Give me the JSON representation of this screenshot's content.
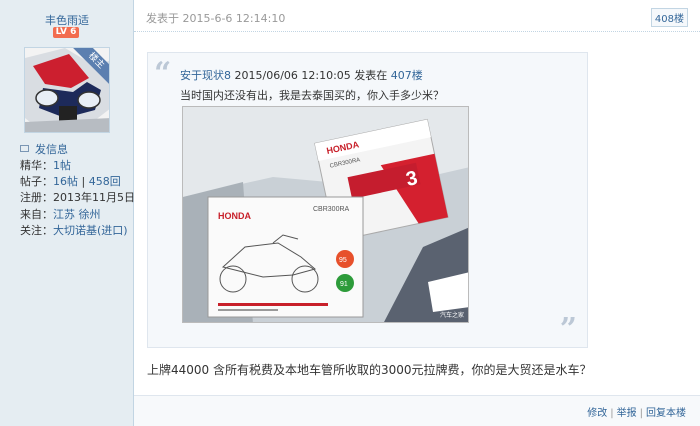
{
  "user": {
    "name": "丰色雨适",
    "level": "LV 6",
    "badge": "楼主",
    "send_message": "发信息",
    "stats": [
      {
        "label": "精华：",
        "value": "1帖"
      },
      {
        "label": "帖子：",
        "value": "16帖",
        "sep": " | ",
        "value2": "458回"
      },
      {
        "label": "注册：",
        "value": "2013年11月5日"
      },
      {
        "label": "来自：",
        "value": "江苏 徐州"
      },
      {
        "label": "关注：",
        "value": "大切诺基(进口)"
      }
    ]
  },
  "post": {
    "time": "发表于 2015-6-6 12:14:10",
    "floor": "408楼",
    "quote": {
      "author": "安于现状8",
      "datetime": " 2015/06/06 12:10:05 发表在 ",
      "floor": "407楼",
      "text": "当时国内还没有出，我是去泰国买的，你入手多少米？",
      "image_caption": "汽车之家",
      "doc": {
        "brand": "HONDA",
        "model": "CBR300RA",
        "card_brand": "HONDA",
        "card_model": "CBR300RA",
        "num1": "95",
        "num2": "91",
        "big_num": "3"
      }
    },
    "body": "上牌44000 含所有税费及本地车管所收取的3000元拉牌费，你的是大贸还是水车？",
    "actions": [
      "修改",
      "举报",
      "回复本楼"
    ]
  }
}
